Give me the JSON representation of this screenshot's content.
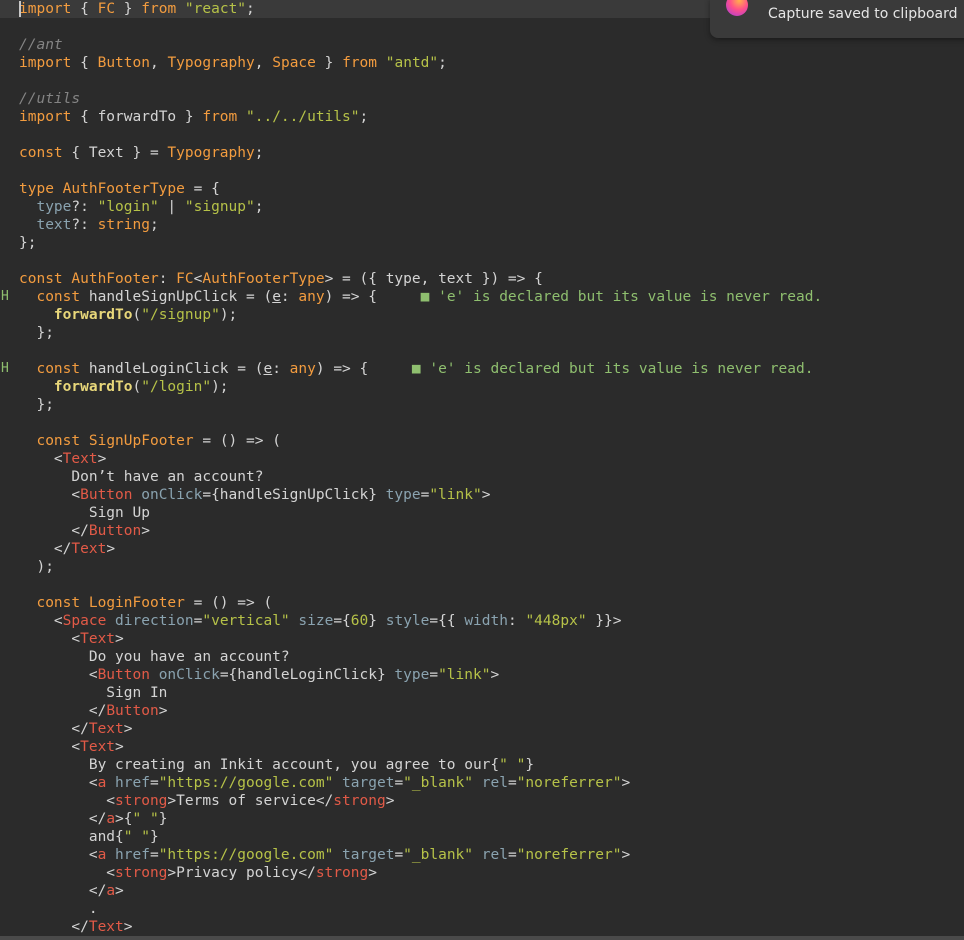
{
  "notification": {
    "text": "Capture saved to clipboard",
    "icon": "app-logo-icon"
  },
  "gutter_marks": [
    {
      "line": 16,
      "text": "H"
    },
    {
      "line": 20,
      "text": "H"
    }
  ],
  "code_lines": [
    [
      [
        "kw",
        "import"
      ],
      [
        "pl",
        " { "
      ],
      [
        "ty",
        "FC"
      ],
      [
        "pl",
        " } "
      ],
      [
        "kw",
        "from"
      ],
      [
        "pl",
        " "
      ],
      [
        "str",
        "\"react\""
      ],
      [
        "pl",
        ";"
      ]
    ],
    [],
    [
      [
        "cm",
        "//ant"
      ]
    ],
    [
      [
        "kw",
        "import"
      ],
      [
        "pl",
        " { "
      ],
      [
        "ty",
        "Button"
      ],
      [
        "pl",
        ", "
      ],
      [
        "ty",
        "Typography"
      ],
      [
        "pl",
        ", "
      ],
      [
        "ty",
        "Space"
      ],
      [
        "pl",
        " } "
      ],
      [
        "kw",
        "from"
      ],
      [
        "pl",
        " "
      ],
      [
        "str",
        "\"antd\""
      ],
      [
        "pl",
        ";"
      ]
    ],
    [],
    [
      [
        "cm",
        "//utils"
      ]
    ],
    [
      [
        "kw",
        "import"
      ],
      [
        "pl",
        " { forwardTo } "
      ],
      [
        "kw",
        "from"
      ],
      [
        "pl",
        " "
      ],
      [
        "str",
        "\"../../utils\""
      ],
      [
        "pl",
        ";"
      ]
    ],
    [],
    [
      [
        "kw",
        "const"
      ],
      [
        "pl",
        " { Text } = "
      ],
      [
        "ty",
        "Typography"
      ],
      [
        "pl",
        ";"
      ]
    ],
    [],
    [
      [
        "kw",
        "type"
      ],
      [
        "pl",
        " "
      ],
      [
        "ty",
        "AuthFooterType"
      ],
      [
        "pl",
        " = {"
      ]
    ],
    [
      [
        "pl",
        "  "
      ],
      [
        "attr",
        "type"
      ],
      [
        "pl",
        "?: "
      ],
      [
        "str",
        "\"login\""
      ],
      [
        "pl",
        " | "
      ],
      [
        "str",
        "\"signup\""
      ],
      [
        "pl",
        ";"
      ]
    ],
    [
      [
        "pl",
        "  "
      ],
      [
        "attr",
        "text"
      ],
      [
        "pl",
        "?: "
      ],
      [
        "ty",
        "string"
      ],
      [
        "pl",
        ";"
      ]
    ],
    [
      [
        "pl",
        "};"
      ]
    ],
    [],
    [
      [
        "kw",
        "const"
      ],
      [
        "pl",
        " "
      ],
      [
        "ty",
        "AuthFooter"
      ],
      [
        "pl",
        ": "
      ],
      [
        "ty",
        "FC"
      ],
      [
        "pl",
        "<"
      ],
      [
        "ty",
        "AuthFooterType"
      ],
      [
        "pl",
        "> = ({ type, text }) => {"
      ]
    ],
    [
      [
        "pl",
        "  "
      ],
      [
        "kw",
        "const"
      ],
      [
        "pl",
        " handleSignUpClick = ("
      ],
      [
        "param",
        "e"
      ],
      [
        "pl",
        ": "
      ],
      [
        "ty",
        "any"
      ],
      [
        "pl",
        ") => {     "
      ],
      [
        "warn",
        "■ 'e' is declared but its value is never read."
      ]
    ],
    [
      [
        "pl",
        "    "
      ],
      [
        "fn",
        "forwardTo"
      ],
      [
        "pl",
        "("
      ],
      [
        "str",
        "\"/signup\""
      ],
      [
        "pl",
        ");"
      ]
    ],
    [
      [
        "pl",
        "  };"
      ]
    ],
    [],
    [
      [
        "pl",
        "  "
      ],
      [
        "kw",
        "const"
      ],
      [
        "pl",
        " handleLoginClick = ("
      ],
      [
        "param",
        "e"
      ],
      [
        "pl",
        ": "
      ],
      [
        "ty",
        "any"
      ],
      [
        "pl",
        ") => {     "
      ],
      [
        "warn",
        "■ 'e' is declared but its value is never read."
      ]
    ],
    [
      [
        "pl",
        "    "
      ],
      [
        "fn",
        "forwardTo"
      ],
      [
        "pl",
        "("
      ],
      [
        "str",
        "\"/login\""
      ],
      [
        "pl",
        ");"
      ]
    ],
    [
      [
        "pl",
        "  };"
      ]
    ],
    [],
    [
      [
        "pl",
        "  "
      ],
      [
        "kw",
        "const"
      ],
      [
        "pl",
        " "
      ],
      [
        "ty",
        "SignUpFooter"
      ],
      [
        "pl",
        " = () => ("
      ]
    ],
    [
      [
        "pl",
        "    <"
      ],
      [
        "tag",
        "Text"
      ],
      [
        "pl",
        ">"
      ]
    ],
    [
      [
        "pl",
        "      Don’t have an account?"
      ]
    ],
    [
      [
        "pl",
        "      <"
      ],
      [
        "tag",
        "Button"
      ],
      [
        "pl",
        " "
      ],
      [
        "attr",
        "onClick"
      ],
      [
        "pl",
        "={handleSignUpClick} "
      ],
      [
        "attr",
        "type"
      ],
      [
        "pl",
        "="
      ],
      [
        "str",
        "\"link\""
      ],
      [
        "pl",
        ">"
      ]
    ],
    [
      [
        "pl",
        "        Sign Up"
      ]
    ],
    [
      [
        "pl",
        "      </"
      ],
      [
        "tag",
        "Button"
      ],
      [
        "pl",
        ">"
      ]
    ],
    [
      [
        "pl",
        "    </"
      ],
      [
        "tag",
        "Text"
      ],
      [
        "pl",
        ">"
      ]
    ],
    [
      [
        "pl",
        "  );"
      ]
    ],
    [],
    [
      [
        "pl",
        "  "
      ],
      [
        "kw",
        "const"
      ],
      [
        "pl",
        " "
      ],
      [
        "ty",
        "LoginFooter"
      ],
      [
        "pl",
        " = () => ("
      ]
    ],
    [
      [
        "pl",
        "    <"
      ],
      [
        "tag",
        "Space"
      ],
      [
        "pl",
        " "
      ],
      [
        "attr",
        "direction"
      ],
      [
        "pl",
        "="
      ],
      [
        "str",
        "\"vertical\""
      ],
      [
        "pl",
        " "
      ],
      [
        "attr",
        "size"
      ],
      [
        "pl",
        "={"
      ],
      [
        "str",
        "60"
      ],
      [
        "pl",
        "} "
      ],
      [
        "attr",
        "style"
      ],
      [
        "pl",
        "={{ "
      ],
      [
        "attr",
        "width"
      ],
      [
        "pl",
        ": "
      ],
      [
        "str",
        "\"448px\""
      ],
      [
        "pl",
        " }}>"
      ]
    ],
    [
      [
        "pl",
        "      <"
      ],
      [
        "tag",
        "Text"
      ],
      [
        "pl",
        ">"
      ]
    ],
    [
      [
        "pl",
        "        Do you have an account?"
      ]
    ],
    [
      [
        "pl",
        "        <"
      ],
      [
        "tag",
        "Button"
      ],
      [
        "pl",
        " "
      ],
      [
        "attr",
        "onClick"
      ],
      [
        "pl",
        "={handleLoginClick} "
      ],
      [
        "attr",
        "type"
      ],
      [
        "pl",
        "="
      ],
      [
        "str",
        "\"link\""
      ],
      [
        "pl",
        ">"
      ]
    ],
    [
      [
        "pl",
        "          Sign In"
      ]
    ],
    [
      [
        "pl",
        "        </"
      ],
      [
        "tag",
        "Button"
      ],
      [
        "pl",
        ">"
      ]
    ],
    [
      [
        "pl",
        "      </"
      ],
      [
        "tag",
        "Text"
      ],
      [
        "pl",
        ">"
      ]
    ],
    [
      [
        "pl",
        "      <"
      ],
      [
        "tag",
        "Text"
      ],
      [
        "pl",
        ">"
      ]
    ],
    [
      [
        "pl",
        "        By creating an Inkit account, you agree to our{"
      ],
      [
        "str",
        "\" \""
      ],
      [
        "pl",
        "}"
      ]
    ],
    [
      [
        "pl",
        "        <"
      ],
      [
        "tag",
        "a"
      ],
      [
        "pl",
        " "
      ],
      [
        "attr",
        "href"
      ],
      [
        "pl",
        "="
      ],
      [
        "str",
        "\"https://google.com\""
      ],
      [
        "pl",
        " "
      ],
      [
        "attr",
        "target"
      ],
      [
        "pl",
        "="
      ],
      [
        "str",
        "\"_blank\""
      ],
      [
        "pl",
        " "
      ],
      [
        "attr",
        "rel"
      ],
      [
        "pl",
        "="
      ],
      [
        "str",
        "\"noreferrer\""
      ],
      [
        "pl",
        ">"
      ]
    ],
    [
      [
        "pl",
        "          <"
      ],
      [
        "tag",
        "strong"
      ],
      [
        "pl",
        ">Terms of service</"
      ],
      [
        "tag",
        "strong"
      ],
      [
        "pl",
        ">"
      ]
    ],
    [
      [
        "pl",
        "        </"
      ],
      [
        "tag",
        "a"
      ],
      [
        "pl",
        ">{"
      ],
      [
        "str",
        "\" \""
      ],
      [
        "pl",
        "}"
      ]
    ],
    [
      [
        "pl",
        "        and{"
      ],
      [
        "str",
        "\" \""
      ],
      [
        "pl",
        "}"
      ]
    ],
    [
      [
        "pl",
        "        <"
      ],
      [
        "tag",
        "a"
      ],
      [
        "pl",
        " "
      ],
      [
        "attr",
        "href"
      ],
      [
        "pl",
        "="
      ],
      [
        "str",
        "\"https://google.com\""
      ],
      [
        "pl",
        " "
      ],
      [
        "attr",
        "target"
      ],
      [
        "pl",
        "="
      ],
      [
        "str",
        "\"_blank\""
      ],
      [
        "pl",
        " "
      ],
      [
        "attr",
        "rel"
      ],
      [
        "pl",
        "="
      ],
      [
        "str",
        "\"noreferrer\""
      ],
      [
        "pl",
        ">"
      ]
    ],
    [
      [
        "pl",
        "          <"
      ],
      [
        "tag",
        "strong"
      ],
      [
        "pl",
        ">Privacy policy</"
      ],
      [
        "tag",
        "strong"
      ],
      [
        "pl",
        ">"
      ]
    ],
    [
      [
        "pl",
        "        </"
      ],
      [
        "tag",
        "a"
      ],
      [
        "pl",
        ">"
      ]
    ],
    [
      [
        "pl",
        "        ."
      ]
    ],
    [
      [
        "pl",
        "      </"
      ],
      [
        "tag",
        "Text"
      ],
      [
        "pl",
        ">"
      ]
    ]
  ],
  "colors": {
    "background": "#2b2b2b",
    "keyword": "#f39c3f",
    "string": "#b6c248",
    "comment": "#848484",
    "tag": "#e25a47",
    "attribute": "#8aa3b0",
    "function": "#e8d77a",
    "diagnostic": "#8fbf6f"
  }
}
